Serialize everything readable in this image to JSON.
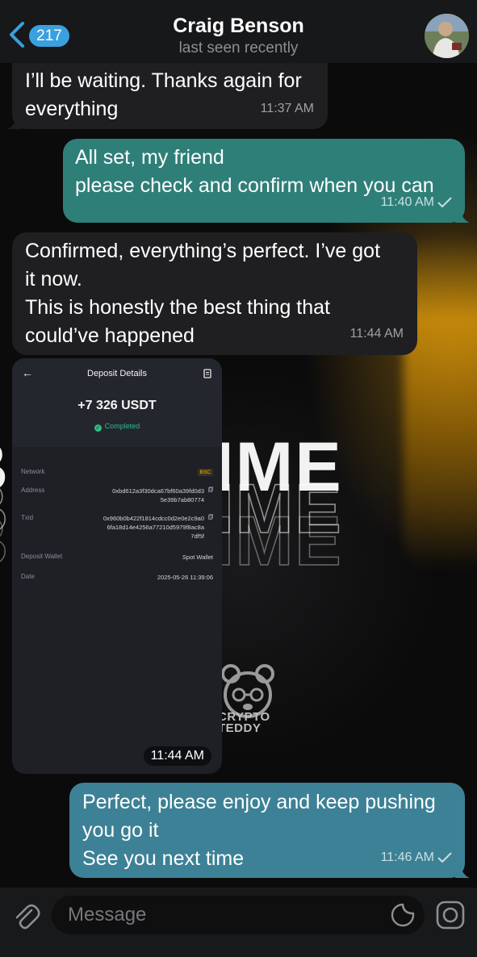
{
  "header": {
    "unread_count": "217",
    "contact_name": "Craig Benson",
    "status": "last seen recently"
  },
  "messages": [
    {
      "direction": "in",
      "text": "I’ll be waiting. Thanks again for\neverything",
      "time": "11:37 AM"
    },
    {
      "direction": "out",
      "text": "All set, my friend\n please check and confirm when you can",
      "time": "11:40 AM",
      "read": true
    },
    {
      "direction": "in",
      "text": "Confirmed, everything’s perfect. I’ve got\nit now.\nThis is honestly the best thing that\ncould’ve happened",
      "time": "11:44 AM"
    },
    {
      "direction": "in",
      "type": "photo",
      "time": "11:44 AM"
    },
    {
      "direction": "out",
      "text": "Perfect, please enjoy and keep pushing\nyou go it\nSee you next time",
      "time": "11:46 AM",
      "read": true
    }
  ],
  "deposit": {
    "title": "Deposit Details",
    "amount": "+7 326 USDT",
    "status": "Completed",
    "network_label": "Network",
    "network_value": "BSC",
    "address_label": "Address",
    "address_value": "0xbd612a3f30dca67bf60a39fd0d3\n5e39b7ab80774",
    "txid_label": "Txid",
    "txid_value": "0x960b0b422f1814cdcc0d2e0e2c9a0\n6fa18d14e4256a77210d5979f8ac8a\n7df5f",
    "wallet_label": "Deposit Wallet",
    "wallet_value": "Spot Wallet",
    "date_label": "Date",
    "date_value": "2025-05-26 11:39:06"
  },
  "wallpaper": {
    "headline": "BEST TIME",
    "logo_text_1": "CRYPTO",
    "logo_text_2": "TEDDY"
  },
  "composer": {
    "placeholder": "Message"
  },
  "colors": {
    "accent": "#3aa0de",
    "incoming_bubble": "#1f1f21",
    "outgoing_bubble": "#2f7f79",
    "outgoing_bubble_2": "#3d8196",
    "completed_green": "#2ebd85",
    "bsc_yellow": "#f0b90b"
  },
  "icons": {
    "back": "chevron-left-icon",
    "attach": "paperclip-icon",
    "sticker": "sticker-icon",
    "camera": "camera-icon",
    "read_receipt": "checkmark-icon"
  }
}
